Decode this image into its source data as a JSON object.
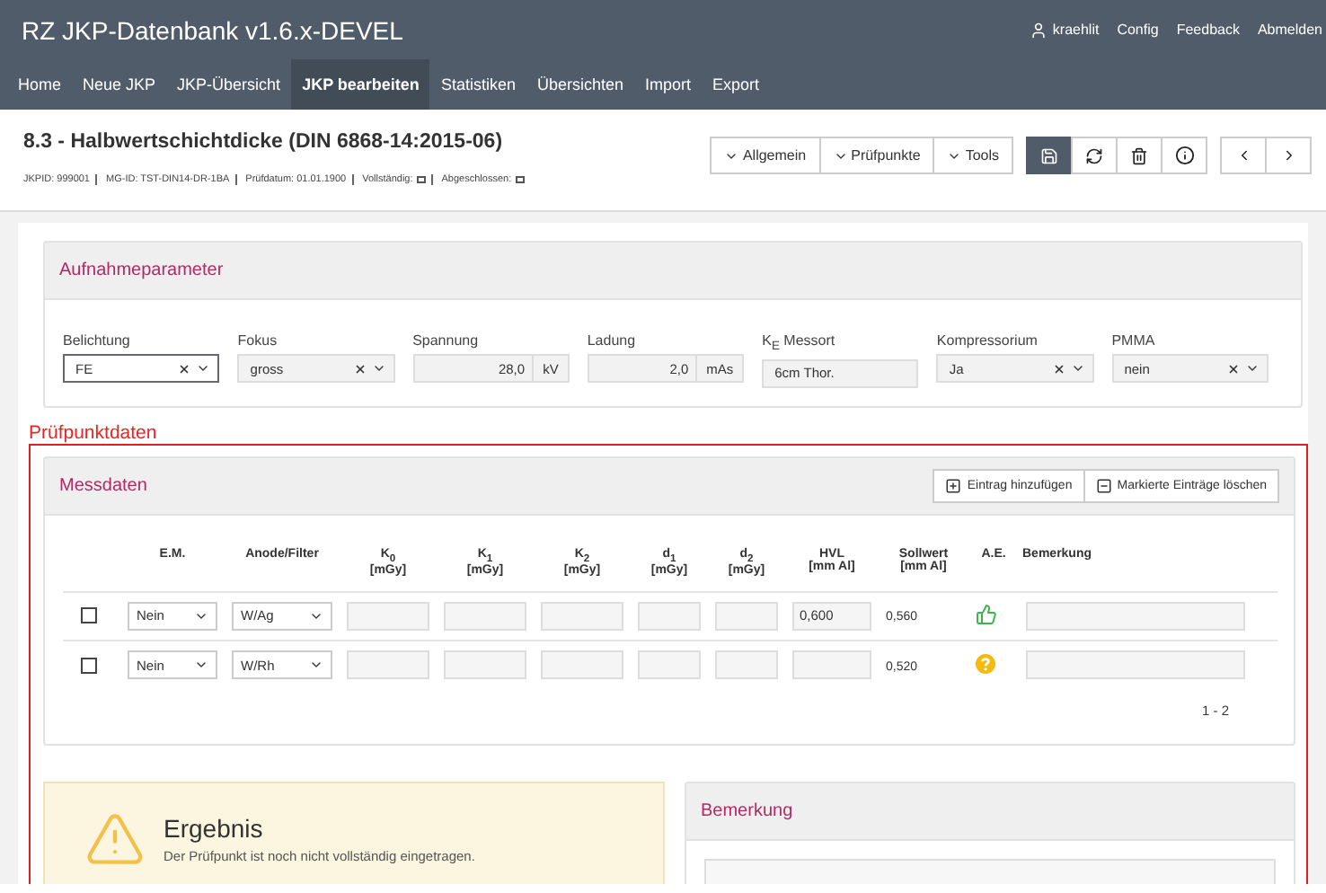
{
  "app_title": "RZ JKP-Datenbank v1.6.x-DEVEL",
  "user_menu": [
    {
      "label": "kraehlit",
      "kind": "user"
    },
    {
      "label": "Config",
      "kind": "link"
    },
    {
      "label": "Feedback",
      "kind": "link"
    },
    {
      "label": "Abmelden",
      "kind": "link"
    }
  ],
  "nav_tabs": [
    {
      "label": "Home",
      "selected": false
    },
    {
      "label": "Neue JKP",
      "selected": false
    },
    {
      "label": "JKP-Übersicht",
      "selected": false
    },
    {
      "label": "JKP bearbeiten",
      "selected": true
    },
    {
      "label": "Statistiken",
      "selected": false
    },
    {
      "label": "Übersichten",
      "selected": false
    },
    {
      "label": "Import",
      "selected": false
    },
    {
      "label": "Export",
      "selected": false
    }
  ],
  "page_title": "8.3 - Halbwertschichtdicke (DIN 6868-14:2015-06)",
  "meta": [
    {
      "label": "JKPID: 999001",
      "kind": "text"
    },
    {
      "label": "MG-ID: TST-DIN14-DR-1BA",
      "kind": "text"
    },
    {
      "label": "Prüfdatum: 01.01.1900",
      "kind": "text"
    },
    {
      "label": "Vollständig:",
      "kind": "checkbox",
      "checked": false
    },
    {
      "label": "Abgeschlossen:",
      "kind": "checkbox",
      "checked": false
    }
  ],
  "dropdown_buttons": [
    "Allgemein",
    "Prüfpunkte",
    "Tools"
  ],
  "tool_buttons": [
    {
      "kind": "save",
      "selected": true
    },
    {
      "kind": "refresh",
      "selected": false
    },
    {
      "kind": "delete",
      "selected": false
    },
    {
      "kind": "info",
      "selected": false
    }
  ],
  "pager_buttons": [
    {
      "kind": "prev"
    },
    {
      "kind": "next"
    }
  ],
  "aufnahme": {
    "title": "Aufnahmeparameter",
    "fields": [
      {
        "label": "Belichtung",
        "kind": "select",
        "value": "FE",
        "disabled": false
      },
      {
        "label": "Fokus",
        "kind": "select",
        "value": "gross",
        "disabled": true
      },
      {
        "label": "Spannung",
        "kind": "number",
        "value": "28,0",
        "unit": "kV",
        "disabled": true
      },
      {
        "label": "Ladung",
        "kind": "number",
        "value": "2,0",
        "unit": "mAs",
        "disabled": true
      },
      {
        "label": "K$_{E}$ Messort",
        "kind": "text",
        "value": "6cm Thor.",
        "disabled": true
      },
      {
        "label": "Kompressorium",
        "kind": "select",
        "value": "Ja",
        "disabled": true
      },
      {
        "label": "PMMA",
        "kind": "select",
        "value": "nein",
        "disabled": true
      }
    ]
  },
  "section_label": "Prüfpunktdaten",
  "messdaten": {
    "title": "Messdaten",
    "buttons": [
      {
        "label": "Eintrag hinzufügen",
        "kind": "add"
      },
      {
        "label": "Markierte Einträge löschen",
        "kind": "remove"
      }
    ],
    "columns": [
      {
        "label": "E.M."
      },
      {
        "label": "Anode/Filter"
      },
      {
        "label": "K$_{0}$",
        "unit": "[mGy]"
      },
      {
        "label": "K$_{1}$",
        "unit": "[mGy]"
      },
      {
        "label": "K$_{2}$",
        "unit": "[mGy]"
      },
      {
        "label": "d$_{1}$",
        "unit": "[mGy]"
      },
      {
        "label": "d$_{2}$",
        "unit": "[mGy]"
      },
      {
        "label": "HVL",
        "unit": "[mm Al]"
      },
      {
        "label": "Sollwert",
        "unit": "[mm Al]"
      },
      {
        "label": "A.E."
      },
      {
        "label": "Bemerkung"
      }
    ],
    "rows": [
      {
        "checked": false,
        "em": "Nein",
        "anode": "W/Ag",
        "k0": "",
        "k1": "",
        "k2": "",
        "d1": "",
        "d2": "",
        "hvl": "0,600",
        "sollwert": "0,560",
        "ae": {
          "kind": "ok"
        }
      },
      {
        "checked": false,
        "em": "Nein",
        "anode": "W/Rh",
        "k0": "",
        "k1": "",
        "k2": "",
        "d1": "",
        "d2": "",
        "hvl": "",
        "sollwert": "0,520",
        "ae": {
          "kind": "unknown"
        }
      }
    ],
    "pagination": "1 - 2"
  },
  "ergebnis": {
    "title": "Ergebnis",
    "message": "Der Prüfpunkt ist noch nicht vollständig eingetragen.",
    "kind": "warning"
  },
  "bemerkung": {
    "title": "Bemerkung"
  }
}
